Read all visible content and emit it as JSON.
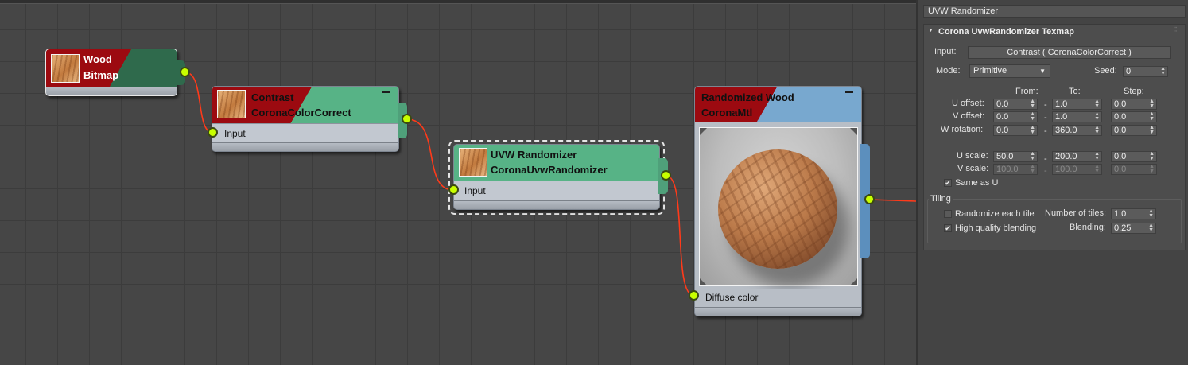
{
  "nodes": {
    "wood_bitmap": {
      "title_line1": "Wood",
      "title_line2": "Bitmap"
    },
    "contrast": {
      "title_line1": "Contrast",
      "title_line2": "CoronaColorCorrect",
      "input_label": "Input"
    },
    "uvw": {
      "title_line1": "UVW Randomizer",
      "title_line2": "CoronaUvwRandomizer",
      "input_label": "Input"
    },
    "material": {
      "title_line1": "Randomized Wood",
      "title_line2": "CoronaMtl",
      "input_label": "Diffuse color"
    }
  },
  "colors": {
    "socket": "#c8ff00",
    "wire": "#ff3a1a",
    "map_header": "#57b386",
    "material_header": "#78a8cf",
    "header_red": "#9c0a10"
  },
  "panel": {
    "title": "UVW Randomizer",
    "rollout_title": "Corona UvwRandomizer Texmap",
    "input_label": "Input:",
    "input_value": "Contrast  ( CoronaColorCorrect )",
    "mode_label": "Mode:",
    "mode_value": "Primitive",
    "seed_label": "Seed:",
    "seed_value": "0",
    "col_from": "From:",
    "col_to": "To:",
    "col_step": "Step:",
    "dash": "-",
    "rows": [
      {
        "label": "U offset:",
        "from": "0.0",
        "to": "1.0",
        "step": "0.0"
      },
      {
        "label": "V offset:",
        "from": "0.0",
        "to": "1.0",
        "step": "0.0"
      },
      {
        "label": "W rotation:",
        "from": "0.0",
        "to": "360.0",
        "step": "0.0"
      },
      {
        "label": "U scale:",
        "from": "50.0",
        "to": "200.0",
        "step": "0.0"
      },
      {
        "label": "V scale:",
        "from": "100.0",
        "to": "100.0",
        "step": "0.0"
      }
    ],
    "same_as_u_label": "Same as U",
    "same_as_u_checked": true,
    "tiling": {
      "group_label": "Tiling",
      "randomize_label": "Randomize each tile",
      "randomize_checked": false,
      "hq_label": "High quality blending",
      "hq_checked": true,
      "num_tiles_label": "Number of tiles:",
      "num_tiles_value": "1.0",
      "blending_label": "Blending:",
      "blending_value": "0.25"
    }
  }
}
